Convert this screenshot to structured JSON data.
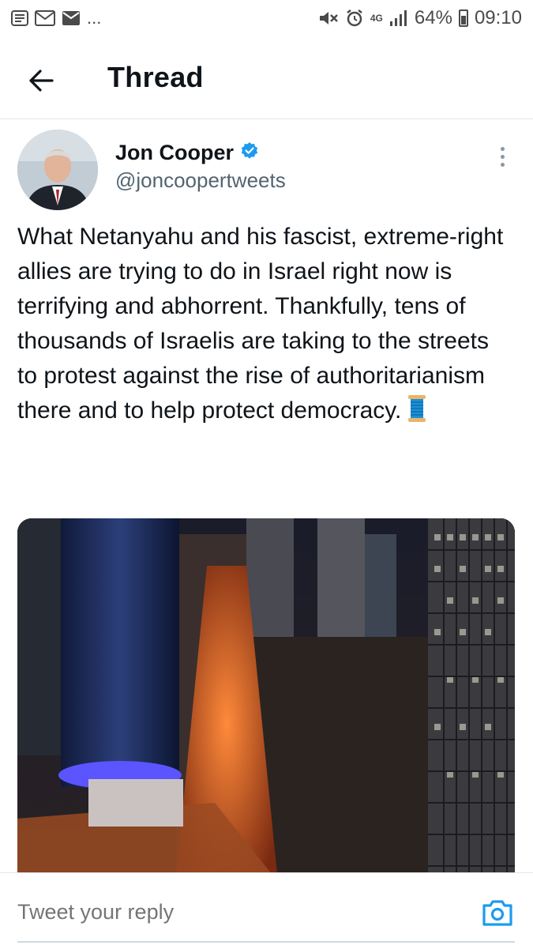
{
  "status_bar": {
    "left_icons": [
      "notification-icon",
      "gmail-icon",
      "message-icon"
    ],
    "more": "...",
    "network": "4G",
    "battery": "64%",
    "time": "09:10"
  },
  "header": {
    "title": "Thread",
    "back_icon": "arrow-left-icon"
  },
  "tweet": {
    "author_name": "Jon Cooper",
    "verified": true,
    "handle": "@joncoopertweets",
    "text": "What Netanyahu and his fascist, extreme-right allies are trying to do in Israel right now is terrifying and abhorrent. Thankfully, tens of thousands of Israelis are taking to the streets to protest against the rise of authoritarianism there and to help protect democracy.",
    "emoji": "spool-of-thread-emoji"
  },
  "reply": {
    "placeholder": "Tweet your reply",
    "camera_icon": "camera-icon"
  },
  "colors": {
    "accent": "#1d9bf0",
    "text": "#0f1419",
    "secondary": "#536471",
    "border": "#e1e6ea"
  }
}
